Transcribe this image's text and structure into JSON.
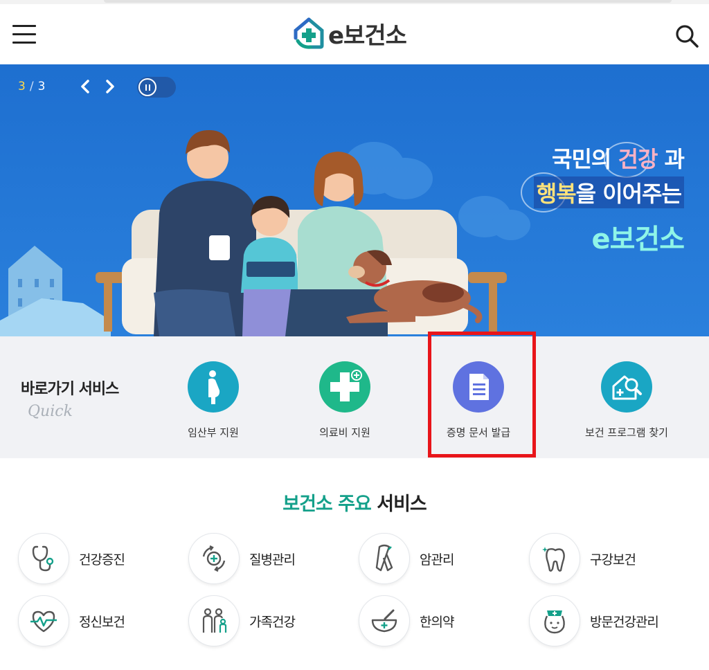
{
  "header": {
    "logo_text": "e보건소"
  },
  "banner": {
    "slide_current": "3",
    "slide_separator": "/",
    "slide_total": "3",
    "tagline_1a": "국민의 ",
    "tagline_1b": "건강",
    "tagline_1c": " 과",
    "tagline_2a": "행복",
    "tagline_2b": "을 이어주는",
    "tagline_3": "e보건소"
  },
  "quick": {
    "title": "바로가기 서비스",
    "subtitle": "Quick",
    "items": [
      {
        "label": "임산부 지원",
        "icon": "pregnant-woman-icon",
        "color": "#1aa6c4"
      },
      {
        "label": "의료비 지원",
        "icon": "medical-plus-icon",
        "color": "#1fb88a"
      },
      {
        "label": "증명 문서 발급",
        "icon": "document-icon",
        "color": "#5f72e0"
      },
      {
        "label": "보건 프로그램 찾기",
        "icon": "house-search-icon",
        "color": "#1aa6c4"
      }
    ]
  },
  "main_services": {
    "title_green": "보건소 주요",
    "title_dark": " 서비스",
    "items": [
      {
        "label": "건강증진",
        "icon": "stethoscope-icon"
      },
      {
        "label": "질병관리",
        "icon": "virus-care-icon"
      },
      {
        "label": "암관리",
        "icon": "cancer-ribbon-icon"
      },
      {
        "label": "구강보건",
        "icon": "tooth-icon"
      },
      {
        "label": "정신보건",
        "icon": "heart-pulse-icon"
      },
      {
        "label": "가족건강",
        "icon": "family-icon"
      },
      {
        "label": "한의약",
        "icon": "mortar-pestle-icon"
      },
      {
        "label": "방문건강관리",
        "icon": "nurse-icon"
      }
    ]
  },
  "colors": {
    "accent_green": "#14a08a",
    "banner_blue": "#1e6fd0",
    "highlight_red": "#e8151a"
  }
}
